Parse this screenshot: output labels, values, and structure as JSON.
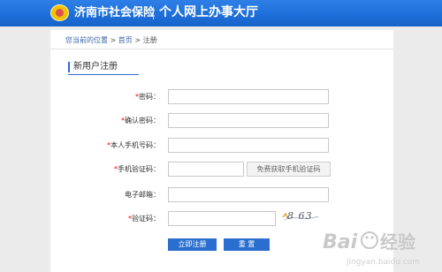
{
  "header": {
    "site_name": "济南市社会保险",
    "site_subtitle": "个人网上办事大厅"
  },
  "breadcrumb": {
    "prefix": "您当前的位置",
    "sep1": ">",
    "home": "首页",
    "sep2": ">",
    "current": "注册"
  },
  "section_title": "新用户注册",
  "form": {
    "password_label": "密码：",
    "confirm_password_label": "确认密码：",
    "phone_label": "本人手机号码：",
    "sms_code_label": "手机验证码：",
    "sms_button": "免费获取手机验证码",
    "email_label": "电子邮箱：",
    "captcha_label": "验证码：",
    "captcha_text": "8 63",
    "required_mark": "*",
    "password_value": "",
    "confirm_password_value": "",
    "phone_value": "",
    "sms_code_value": "",
    "email_value": "",
    "captcha_value": ""
  },
  "buttons": {
    "register": "立即注册",
    "reset": "重  置"
  },
  "colors": {
    "header_blue": "#1e6fd9",
    "accent_blue": "#2a6fcf",
    "required_red": "#e60000"
  }
}
